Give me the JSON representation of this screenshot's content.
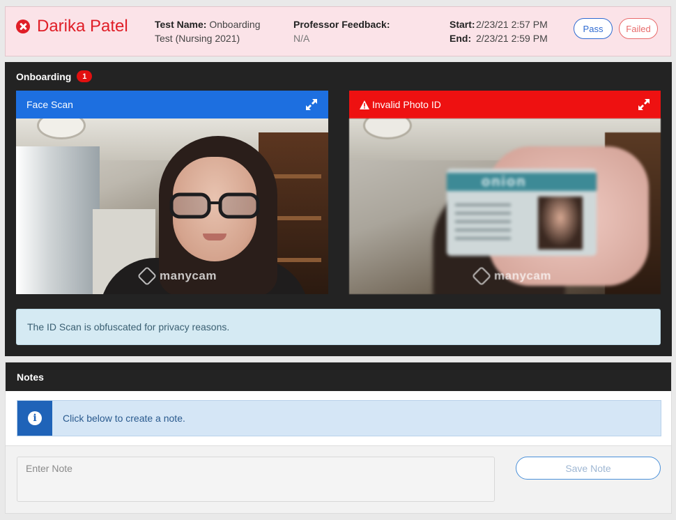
{
  "header": {
    "student_name": "Darika Patel",
    "status_icon": "x-circle-icon",
    "test_name_label": "Test Name:",
    "test_name_value": "Onboarding Test (Nursing 2021)",
    "professor_feedback_label": "Professor Feedback:",
    "professor_feedback_value": "N/A",
    "start_label": "Start:",
    "start_value": "2/23/21 2:57 PM",
    "end_label": "End:",
    "end_value": "2/23/21 2:59 PM",
    "pass_label": "Pass",
    "failed_label": "Failed",
    "colors": {
      "fail_red": "#e01e27",
      "pass_blue": "#2e6ad1"
    }
  },
  "onboarding": {
    "title": "Onboarding",
    "badge_count": "1",
    "face_scan": {
      "title": "Face Scan",
      "watermark": "manycam",
      "header_color": "#1d6fe0"
    },
    "photo_id": {
      "title": "Invalid Photo ID",
      "watermark": "manycam",
      "card_text": "onion",
      "header_color": "#ee1111"
    },
    "notice": "The ID Scan is obfuscated for privacy reasons."
  },
  "notes": {
    "title": "Notes",
    "info_text": "Click below to create a note.",
    "input_placeholder": "Enter Note",
    "save_label": "Save Note"
  }
}
